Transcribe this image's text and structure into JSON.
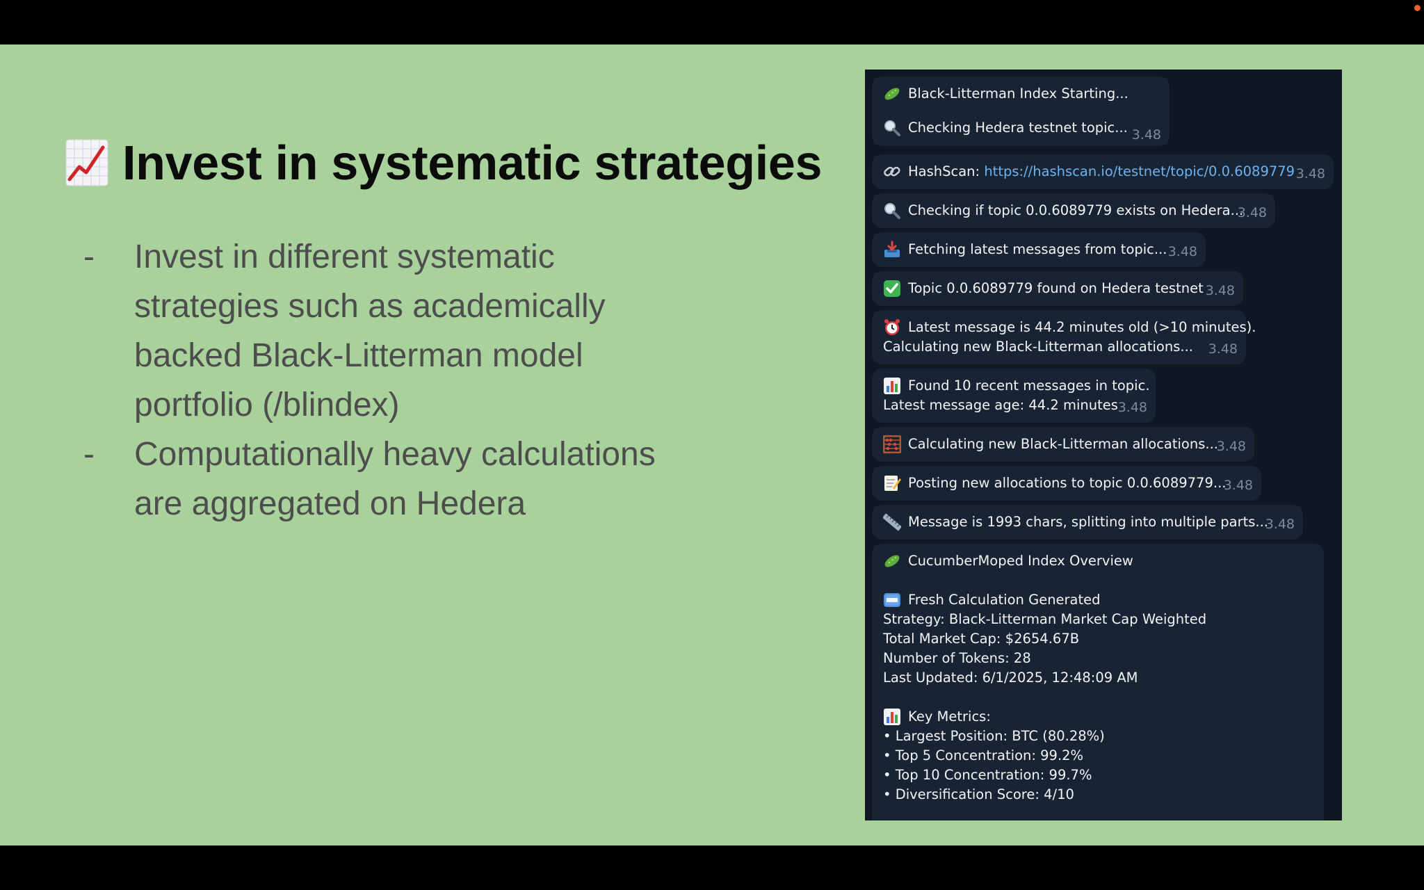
{
  "slide": {
    "title": "Invest in systematic strategies",
    "bullets": [
      "Invest in different systematic strategies such as academically backed Black-Litterman model portfolio (/blindex)",
      "Computationally heavy calculations are aggregated on Hedera"
    ],
    "bullet_marker": "-",
    "background_color": "#a9d19b"
  },
  "chat": {
    "messages": [
      {
        "icon": "cucumber-icon",
        "text": "Black-Litterman Index Starting...",
        "time": ""
      },
      {
        "icon": "magnifier-icon",
        "text": "Checking Hedera testnet topic...",
        "time": "3.48"
      },
      {
        "icon": "link-icon",
        "text": "HashScan: ",
        "link": "https://hashscan.io/testnet/topic/0.0.6089779",
        "time": "3.48"
      },
      {
        "icon": "magnifier-icon",
        "text": "Checking if topic 0.0.6089779 exists on Hedera...",
        "time": "3.48"
      },
      {
        "icon": "inbox-tray-icon",
        "text": "Fetching latest messages from topic...",
        "time": "3.48"
      },
      {
        "icon": "check-mark-icon",
        "text": "Topic 0.0.6089779 found on Hedera testnet",
        "time": "3.48"
      },
      {
        "icon": "alarm-clock-icon",
        "text": "Latest message is 44.2 minutes old (>10 minutes).",
        "text2": "Calculating new Black-Litterman allocations...",
        "time": "3.48"
      },
      {
        "icon": "bar-chart-icon",
        "text": "Found 10 recent messages in topic.",
        "text2": "Latest message age: 44.2 minutes",
        "time": "3.48"
      },
      {
        "icon": "abacus-icon",
        "text": "Calculating new Black-Litterman allocations...",
        "time": "3.48"
      },
      {
        "icon": "memo-icon",
        "text": "Posting new allocations to topic 0.0.6089779...",
        "time": "3.48"
      },
      {
        "icon": "ruler-icon",
        "text": "Message is 1993 chars, splitting into multiple parts...",
        "time": "3.48"
      }
    ],
    "overview": {
      "header_icon": "cucumber-icon",
      "header": "CucumberMoped Index Overview",
      "fresh_icon": "new-badge-icon",
      "fresh": "Fresh Calculation Generated",
      "details": [
        "Strategy: Black-Litterman Market Cap Weighted",
        "Total Market Cap: $2654.67B",
        "Number of Tokens: 28",
        "Last Updated: 6/1/2025, 12:48:09 AM"
      ],
      "metrics_icon": "bar-chart-icon",
      "metrics_header": "Key Metrics:",
      "metrics": [
        "• Largest Position: BTC (80.28%)",
        "• Top 5 Concentration: 99.2%",
        "• Top 10 Concentration: 99.7%",
        "• Diversification Score: 4/10"
      ]
    }
  }
}
